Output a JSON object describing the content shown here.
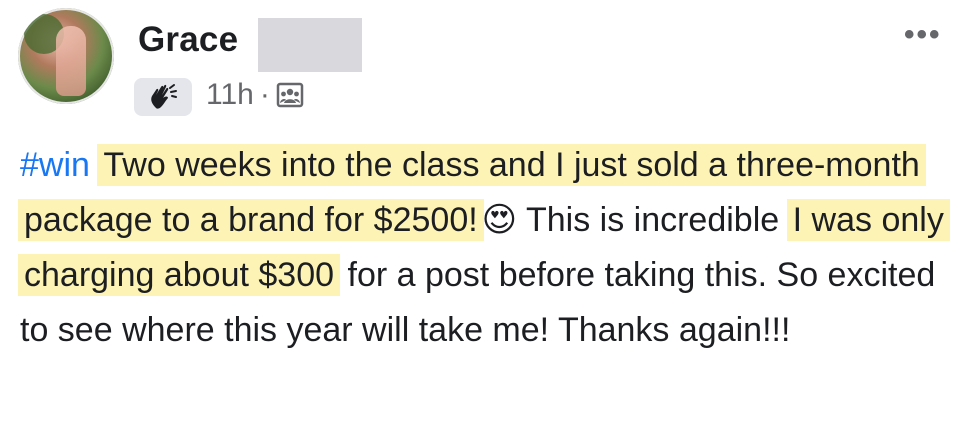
{
  "author": {
    "name": "Grace"
  },
  "meta": {
    "time": "11h",
    "separator": "·"
  },
  "post": {
    "hashtag": "#win",
    "highlight1": "Two weeks into the class and I just sold a three-month package to a brand for $2500!",
    "emoji": "😍",
    "plain1": "This is incredible",
    "highlight2": "I was only charging about $300",
    "plain2": "for a post before taking this. So excited to see where this year will take me! Thanks again!!!"
  },
  "colors": {
    "highlight": "#fdf3b4",
    "link": "#1877f2",
    "muted": "#65676b"
  },
  "icons": {
    "more": "more-horizontal-icon",
    "badge": "waving-hand-icon",
    "audience": "group-audience-icon"
  }
}
